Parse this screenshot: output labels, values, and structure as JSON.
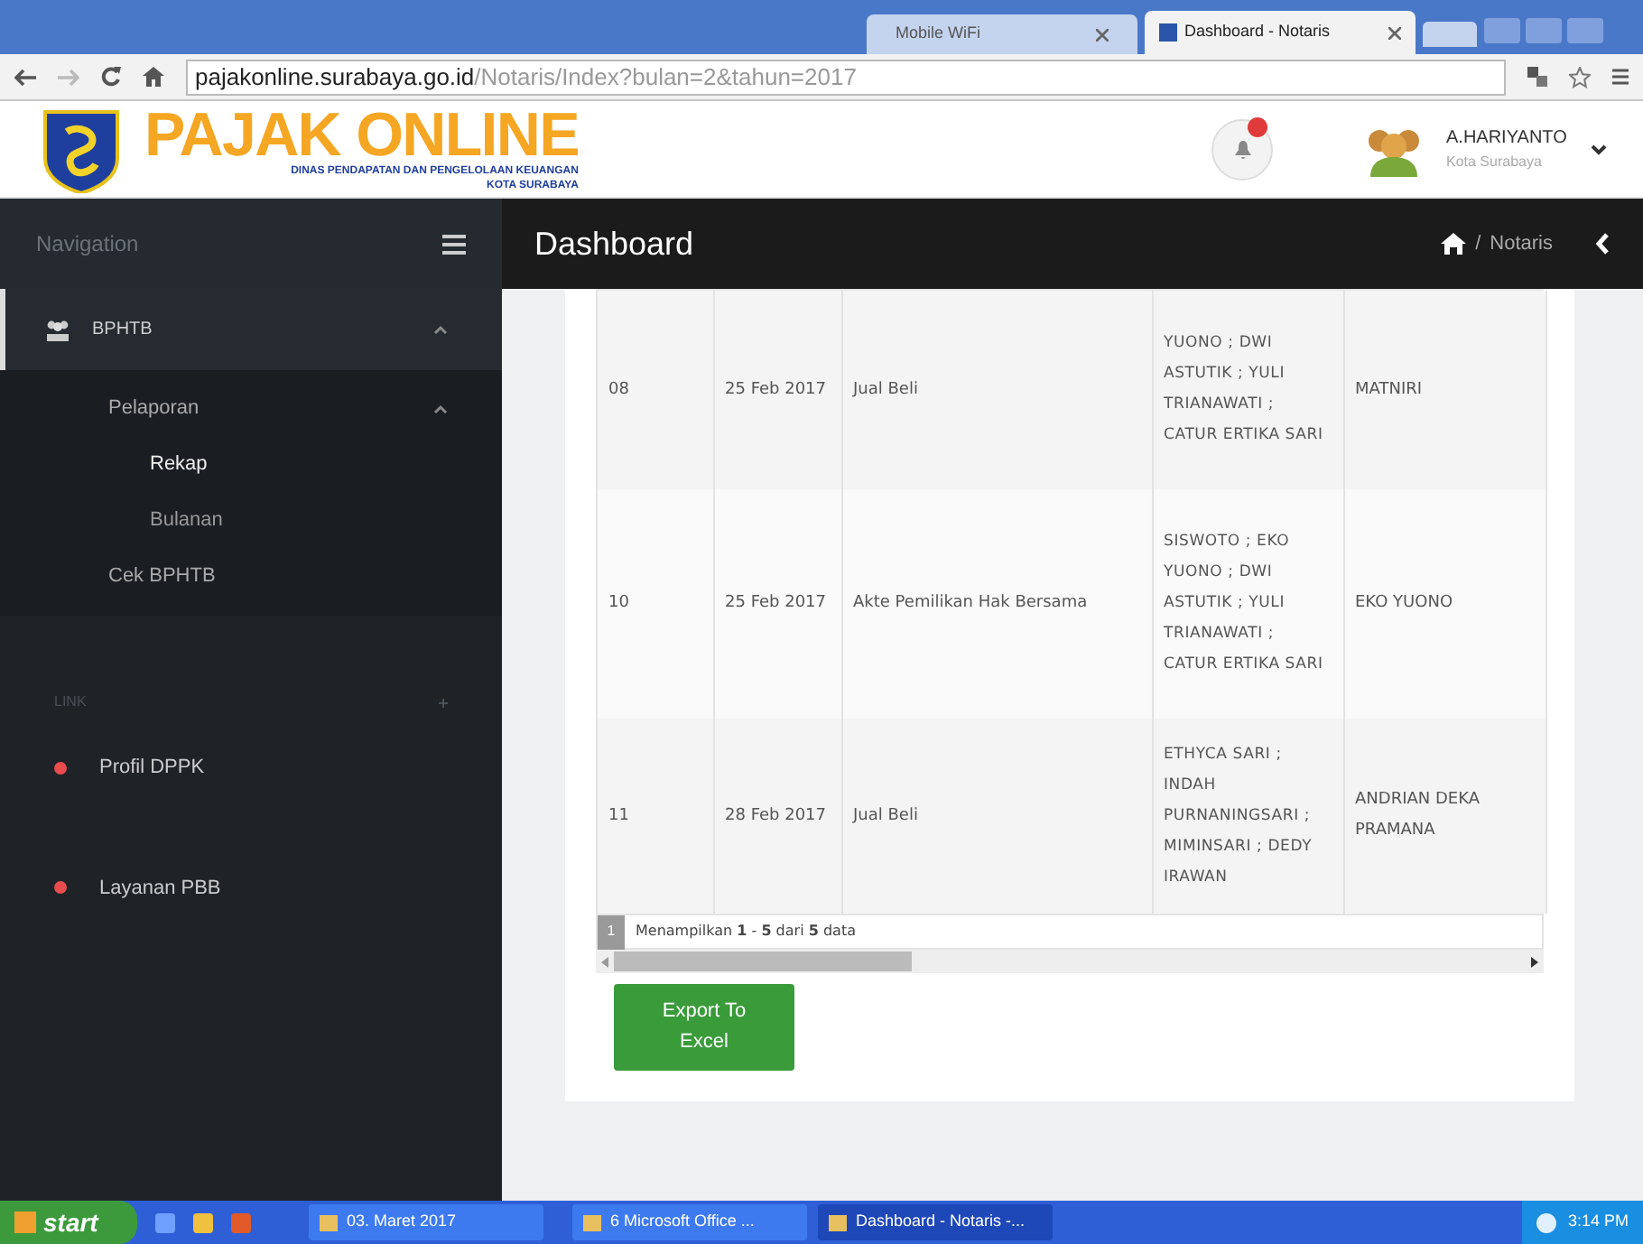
{
  "browser": {
    "tabs": [
      {
        "label": "Mobile WiFi",
        "selected": false
      },
      {
        "label": "Dashboard - Notaris",
        "selected": true
      }
    ],
    "url_domain": "pajakonline.surabaya.go.id",
    "url_path": "/Notaris/Index?bulan=2&tahun=2017"
  },
  "header": {
    "logo_title": "PAJAK ONLINE",
    "logo_subtitle": "DINAS PENDAPATAN DAN PENGELOLAAN KEUANGAN",
    "logo_subtitle_2": "KOTA SURABAYA",
    "user_name": "A.HARIYANTO",
    "user_city": "Kota Surabaya"
  },
  "navbar": {
    "sidebar_title": "Navigation",
    "page_title": "Dashboard",
    "breadcrumb_separator": "/",
    "breadcrumb": "Notaris"
  },
  "sidebar": {
    "items": [
      {
        "label": "BPHTB",
        "expanded": true,
        "children": [
          {
            "label": "Pelaporan",
            "expanded": true,
            "children": [
              {
                "label": "Rekap",
                "selected": true
              },
              {
                "label": "Bulanan",
                "selected": false
              }
            ]
          },
          {
            "label": "Cek BPHTB"
          }
        ]
      }
    ],
    "section_title": "LINK",
    "links": [
      {
        "label": "Profil DPPK",
        "color": "#e84c4c"
      },
      {
        "label": "Layanan PBB",
        "color": "#e84c4c"
      }
    ]
  },
  "table": {
    "rows": [
      {
        "no": "08",
        "date": "25 Feb 2017",
        "type": "Jual Beli",
        "parties": "YUONO ; DWI ASTUTIK ; YULI TRIANAWATI ; CATUR ERTIKA SARI",
        "name": "MATNIRI"
      },
      {
        "no": "10",
        "date": "25 Feb 2017",
        "type": "Akte Pemilikan Hak Bersama",
        "parties": "SISWOTO ; EKO YUONO ; DWI ASTUTIK ; YULI TRIANAWATI ; CATUR ERTIKA SARI",
        "name": "EKO YUONO"
      },
      {
        "no": "11",
        "date": "28 Feb 2017",
        "type": "Jual Beli",
        "parties": "ETHYCA SARI ; INDAH PURNANINGSARI ; MIMINSARI ; DEDY IRAWAN",
        "name": "ANDRIAN DEKA PRAMANA"
      }
    ],
    "page": "1",
    "summary": "Menampilkan **1** - **5** dari **5** data"
  },
  "export_button": "Export To Excel",
  "taskbar": {
    "start": "start",
    "tasks": [
      {
        "label": "03. Maret 2017",
        "selected": false
      },
      {
        "label": "6 Microsoft Office ...",
        "selected": false
      },
      {
        "label": "Dashboard - Notaris -...",
        "selected": true
      }
    ],
    "clock": "3:14 PM"
  }
}
